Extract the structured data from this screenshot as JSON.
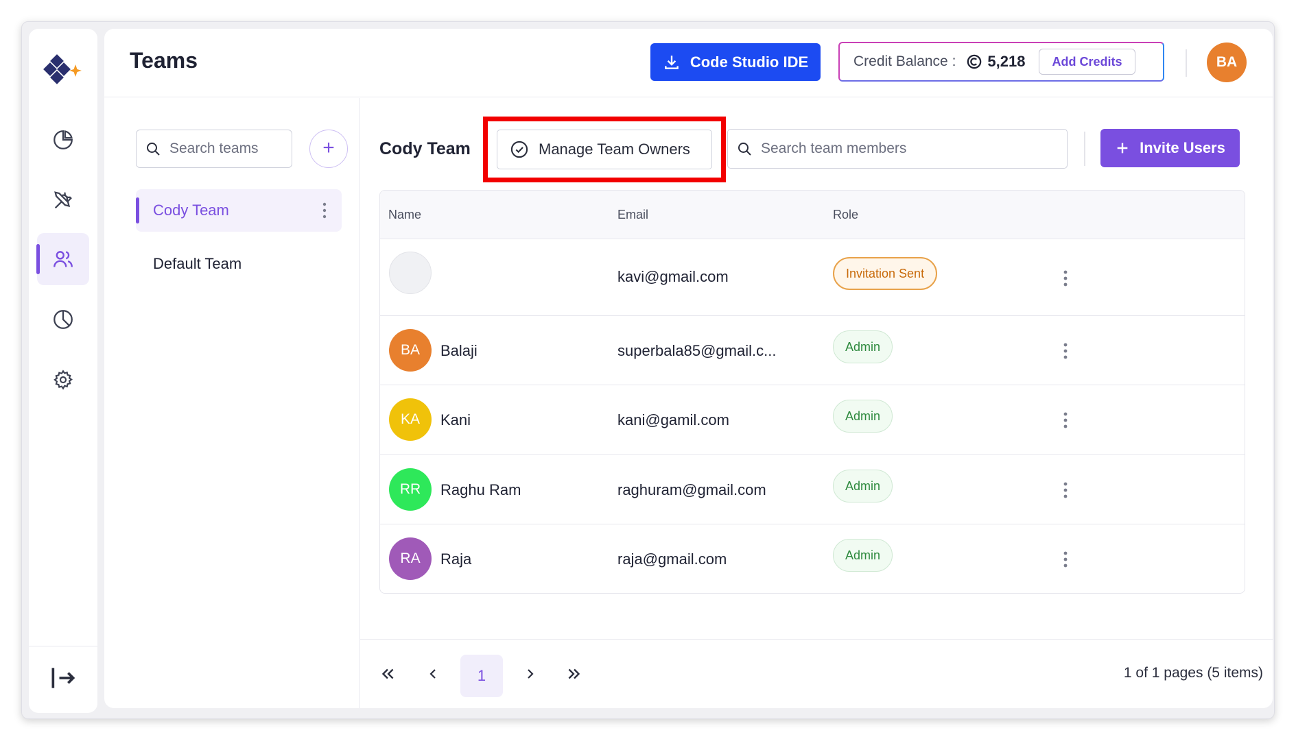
{
  "page": {
    "title": "Teams"
  },
  "topbar": {
    "ide_button": "Code Studio IDE",
    "credit_label": "Credit Balance :",
    "credit_value": "5,218",
    "add_credits": "Add Credits",
    "user_initials": "BA"
  },
  "sidebar": {
    "items": [
      {
        "name": "pie-chart-icon",
        "active": false
      },
      {
        "name": "tools-icon",
        "active": false
      },
      {
        "name": "users-icon",
        "active": true
      },
      {
        "name": "pie-chart-outline-icon",
        "active": false
      },
      {
        "name": "gear-icon",
        "active": false
      }
    ],
    "logout_icon": "logout-icon"
  },
  "teams": {
    "search_placeholder": "Search teams",
    "list": [
      {
        "label": "Cody Team",
        "active": true
      },
      {
        "label": "Default Team",
        "active": false
      }
    ]
  },
  "team_view": {
    "title": "Cody Team",
    "manage_owners": "Manage Team Owners",
    "search_placeholder": "Search team members",
    "invite_button": "Invite Users",
    "columns": [
      "Name",
      "Email",
      "Role"
    ],
    "members": [
      {
        "initials": "",
        "name": "",
        "email": "kavi@gmail.com",
        "role": "Invitation Sent",
        "color": "#f0f1f4"
      },
      {
        "initials": "BA",
        "name": "Balaji",
        "email": "superbala85@gmail.c...",
        "role": "Admin",
        "color": "#e8802e"
      },
      {
        "initials": "KA",
        "name": "Kani",
        "email": "kani@gamil.com",
        "role": "Admin",
        "color": "#f0c20a"
      },
      {
        "initials": "RR",
        "name": "Raghu Ram",
        "email": "raghuram@gmail.com",
        "role": "Admin",
        "color": "#2ee85a"
      },
      {
        "initials": "RA",
        "name": "Raja",
        "email": "raja@gmail.com",
        "role": "Admin",
        "color": "#a05ab8"
      }
    ]
  },
  "pagination": {
    "current": "1",
    "info": "1 of 1 pages (5 items)"
  },
  "colors": {
    "accent": "#7a4fe0",
    "ide_blue": "#1c4bf2",
    "highlight": "#f20000"
  }
}
